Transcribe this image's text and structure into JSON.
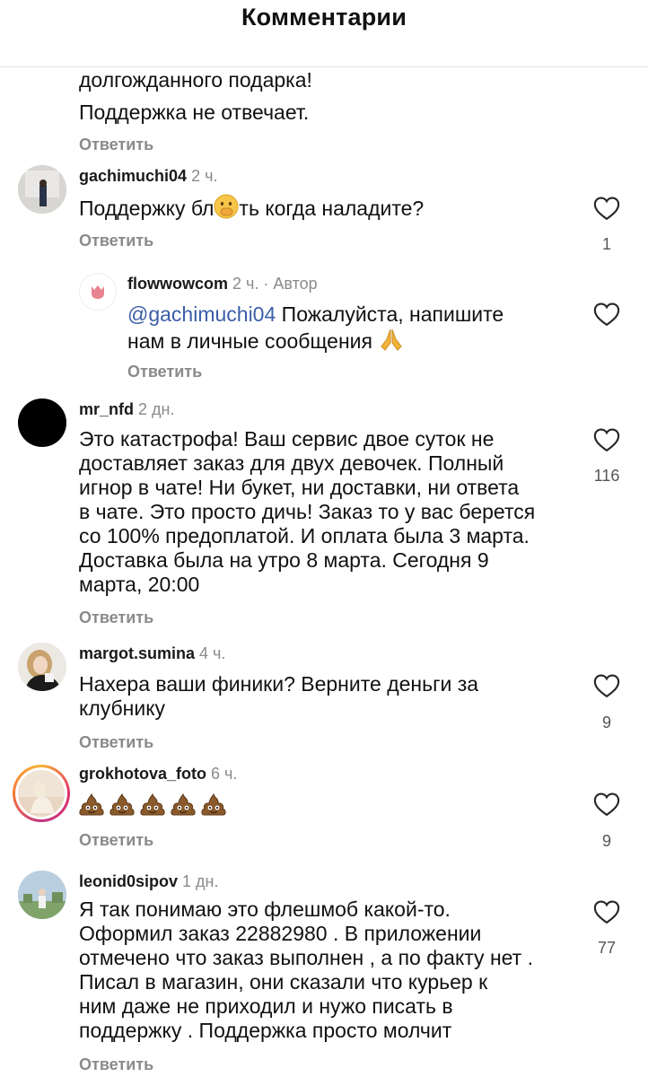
{
  "header": {
    "title": "Комментарии"
  },
  "reply_label": "Ответить",
  "comments": [
    {
      "lines": [
        "долгожданного подарка!",
        "Поддержка не отвечает."
      ]
    },
    {
      "username": "gachimuchi04",
      "time": "2 ч.",
      "text_before": "Поддержку бл",
      "emoji": "face-with-hand-over-mouth",
      "text_after": "ть когда наладите?",
      "likes": "1"
    },
    {
      "username": "flowwowcom",
      "time": "2 ч. · Автор",
      "mention": "@gachimuchi04",
      "text_line1_rest": " Пожалуйста, напишите",
      "text_line2": "нам в личные сообщения ",
      "emoji": "folded-hands"
    },
    {
      "username": "mr_nfd",
      "time": "2 дн.",
      "lines": [
        "Это катастрофа! Ваш сервис двое суток не",
        "доставляет заказ для двух девочек. Полный",
        "игнор в чате! Ни букет, ни доставки, ни ответа",
        "в чате. Это просто дичь! Заказ то у вас берется",
        "со 100% предоплатой. И оплата была 3 марта.",
        "Доставка была на утро 8 марта. Сегодня 9",
        "марта, 20:00"
      ],
      "likes": "116"
    },
    {
      "username": "margot.sumina",
      "time": "4 ч.",
      "lines": [
        "Нахера ваши финики? Верните деньги за",
        "клубнику"
      ],
      "likes": "9"
    },
    {
      "username": "grokhotova_foto",
      "time": "6 ч.",
      "emoji": "pile-of-poo x5",
      "likes": "9"
    },
    {
      "username": "leonid0sipov",
      "time": "1 дн.",
      "lines": [
        "Я так понимаю это флешмоб какой-то.",
        "Оформил заказ 22882980 . В приложении",
        "отмечено что заказ выполнен , а по факту нет .",
        "Писал в  магазин, они сказали что курьер к",
        "ним даже не приходил и нужо писать в",
        "поддержку . Поддержка просто молчит"
      ],
      "likes": "77"
    }
  ]
}
